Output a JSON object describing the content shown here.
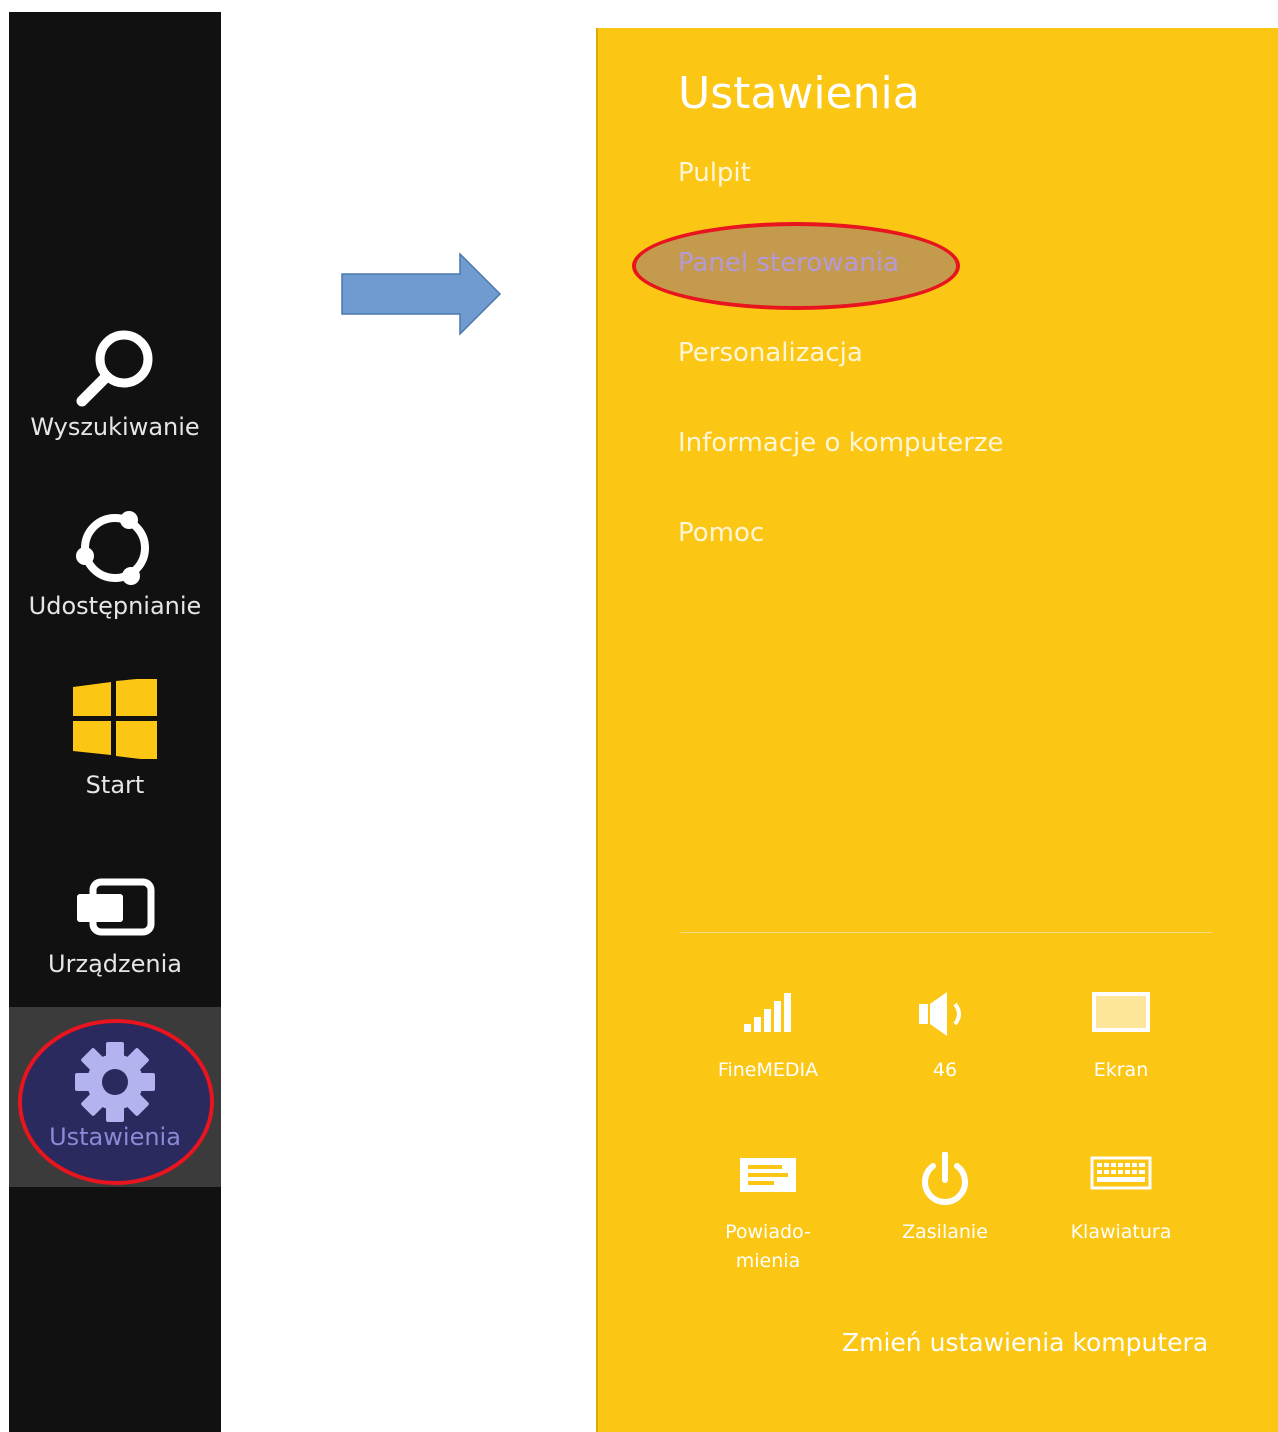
{
  "charms": {
    "search": {
      "label": "Wyszukiwanie",
      "icon": "search-icon"
    },
    "share": {
      "label": "Udostępnianie",
      "icon": "share-icon"
    },
    "start": {
      "label": "Start",
      "icon": "windows-logo-icon"
    },
    "devices": {
      "label": "Urządzenia",
      "icon": "devices-icon"
    },
    "settings": {
      "label": "Ustawienia",
      "icon": "gear-icon",
      "active": true
    }
  },
  "pane": {
    "title": "Ustawienia",
    "menu": [
      {
        "label": "Pulpit"
      },
      {
        "label": "Panel sterowania",
        "highlighted": true
      },
      {
        "label": "Personalizacja"
      },
      {
        "label": "Informacje o komputerze"
      },
      {
        "label": "Pomoc"
      }
    ],
    "tiles": [
      {
        "label": "FineMEDIA",
        "icon": "network-signal-icon"
      },
      {
        "label": "46",
        "icon": "volume-icon"
      },
      {
        "label": "Ekran",
        "icon": "screen-brightness-icon"
      },
      {
        "label": "Powiado-\nmienia",
        "icon": "notifications-icon"
      },
      {
        "label": "Zasilanie",
        "icon": "power-icon"
      },
      {
        "label": "Klawiatura",
        "icon": "keyboard-icon"
      }
    ],
    "change_settings": "Zmień ustawienia komputera"
  },
  "colors": {
    "charms_bg": "#111111",
    "pane_bg": "#fcc614",
    "highlight_ring": "#e8141e",
    "arrow": "#6f9bd1"
  }
}
